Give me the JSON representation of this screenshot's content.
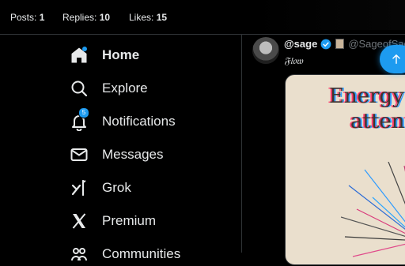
{
  "stats": [
    {
      "label": "Posts:",
      "value": "1"
    },
    {
      "label": "Replies:",
      "value": "10"
    },
    {
      "label": "Likes:",
      "value": "15"
    }
  ],
  "nav": {
    "items": [
      {
        "label": "Home",
        "icon": "home-icon",
        "active": true
      },
      {
        "label": "Explore",
        "icon": "search-icon"
      },
      {
        "label": "Notifications",
        "icon": "bell-icon",
        "badge": "5"
      },
      {
        "label": "Messages",
        "icon": "envelope-icon"
      },
      {
        "label": "Grok",
        "icon": "grok-icon"
      },
      {
        "label": "Premium",
        "icon": "x-logo-icon"
      },
      {
        "label": "Communities",
        "icon": "communities-icon"
      }
    ]
  },
  "post": {
    "display_name": "@sage",
    "handle": "@SageofSag",
    "text": "𝔉𝔩𝔬𝔴",
    "media": {
      "line1": "Energy",
      "line2": "attent"
    }
  },
  "colors": {
    "accent": "#1d9bf0",
    "background": "#000000",
    "border": "#2f3336",
    "muted": "#71767b"
  }
}
